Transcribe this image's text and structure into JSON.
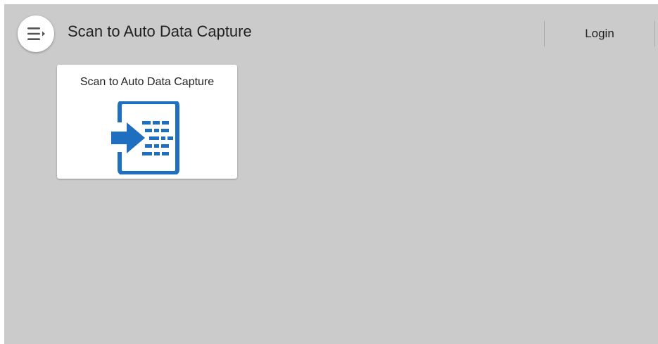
{
  "header": {
    "title": "Scan to Auto Data Capture",
    "menu_icon": "menu-icon",
    "login_label": "Login"
  },
  "tiles": [
    {
      "label": "Scan to Auto Data Capture",
      "icon": "scan-data-capture-icon"
    }
  ],
  "colors": {
    "background": "#cbcbcb",
    "tile_background": "#ffffff",
    "icon_blue": "#1e6fbf",
    "text": "#222222"
  }
}
